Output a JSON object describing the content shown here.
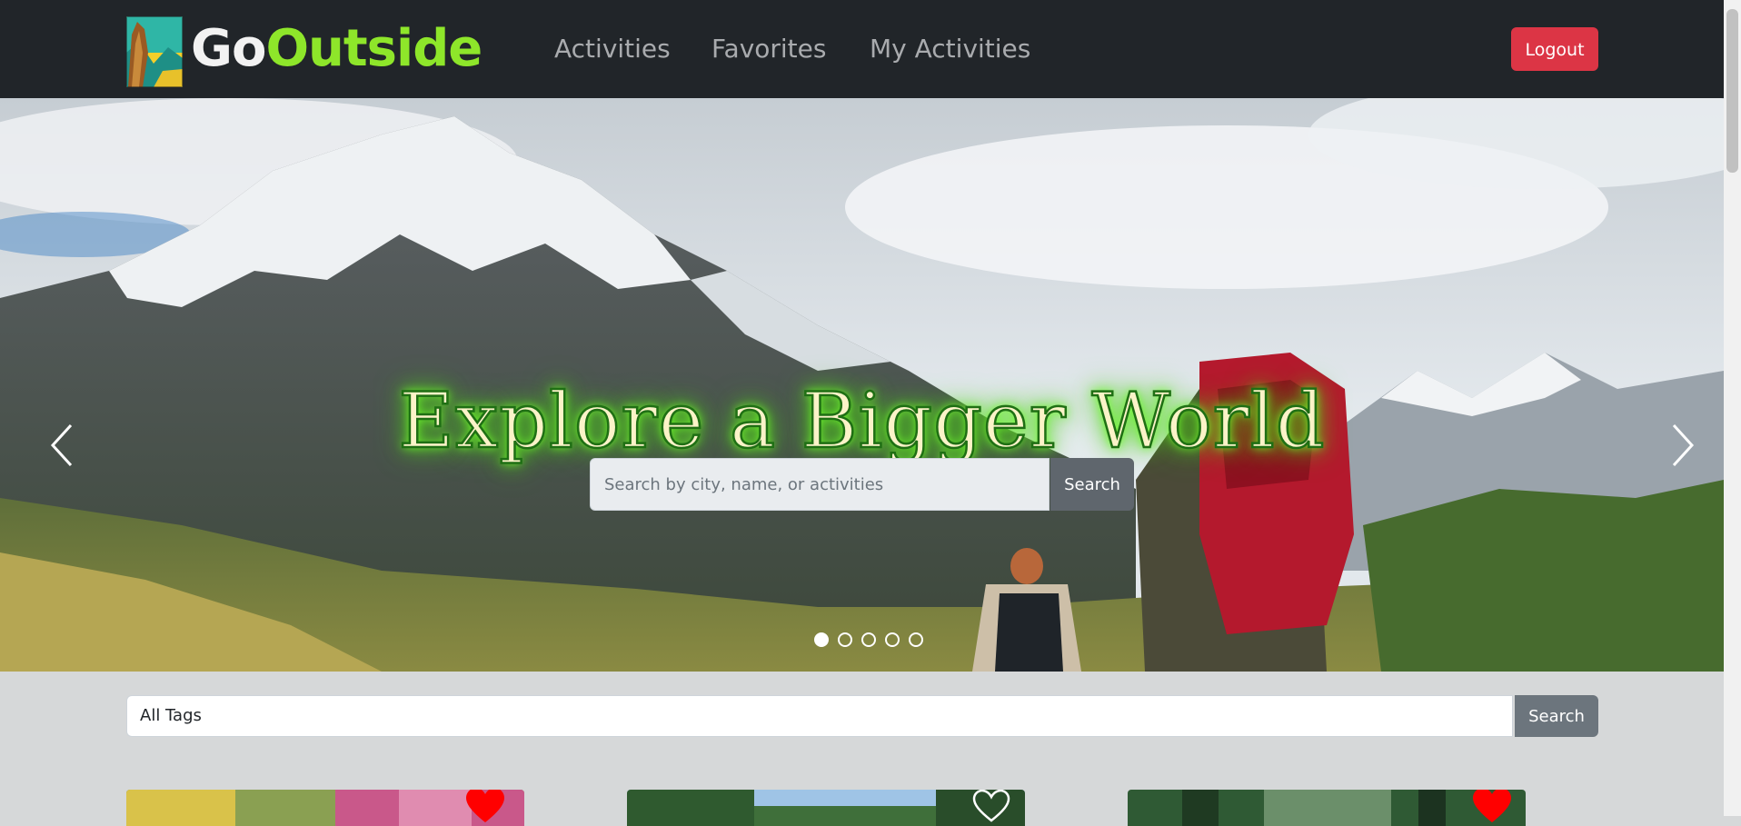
{
  "navbar": {
    "logo": {
      "part1": "Go",
      "part2": "Outside"
    },
    "links": [
      "Activities",
      "Favorites",
      "My Activities"
    ],
    "logout_label": "Logout"
  },
  "hero": {
    "title": "Explore a Bigger World",
    "search_placeholder": "Search by city, name, or activities",
    "search_button": "Search",
    "slide_count": 5,
    "active_slide": 1
  },
  "tags": {
    "selected": "All Tags",
    "search_button": "Search"
  },
  "cards": [
    {
      "favorited": true
    },
    {
      "favorited": false
    },
    {
      "favorited": true
    }
  ],
  "colors": {
    "navbar_bg": "#212529",
    "logo_accent": "#8ee62a",
    "logout_bg": "#dc3545",
    "page_bg": "#d6d8d9",
    "heart_filled": "#ff0000"
  }
}
